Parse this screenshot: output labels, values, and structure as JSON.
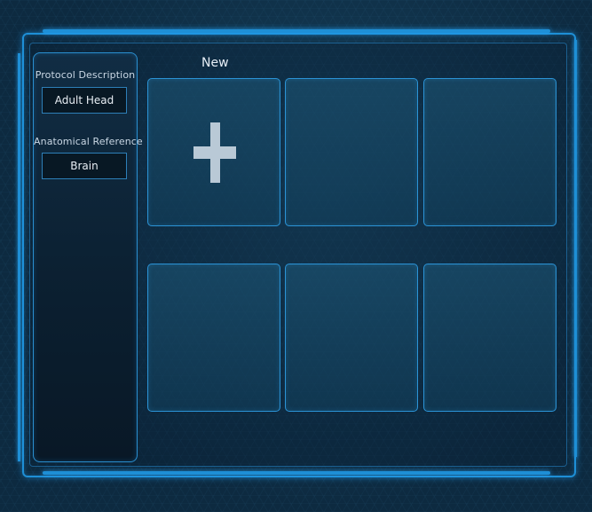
{
  "sidebar": {
    "protocol_label": "Protocol Description",
    "protocol_value": "Adult Head",
    "anatomy_label": "Anatomical Reference",
    "anatomy_value": "Brain"
  },
  "main": {
    "title": "New",
    "tiles": [
      {
        "icon": "plus-icon",
        "empty": false
      },
      {
        "empty": true
      },
      {
        "empty": true
      },
      {
        "empty": true
      },
      {
        "empty": true
      },
      {
        "empty": true
      }
    ]
  },
  "colors": {
    "accent": "#1e8fd6",
    "background": "#0d2a40",
    "tile_border": "#2b93d6",
    "plus": "#b9c9d6"
  }
}
